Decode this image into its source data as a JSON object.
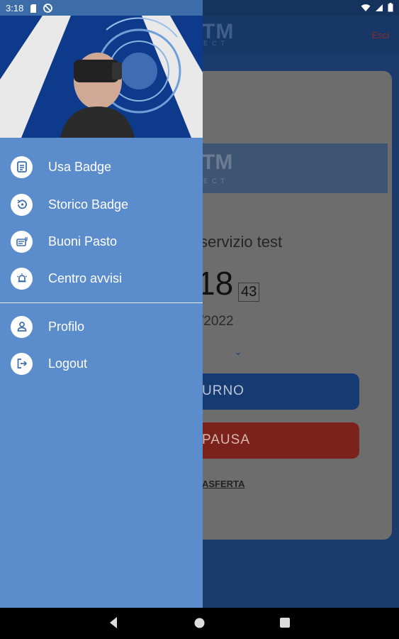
{
  "status_bar": {
    "time": "3:18"
  },
  "app": {
    "logo": "TM",
    "logo_sub": "ECT",
    "exit_label": "Esci",
    "service_name": "servizio test",
    "time_hm": "18",
    "time_sec": "43",
    "date": "/2022",
    "turno_label": "URNO",
    "pausa_label": "PAUSA",
    "trasferta_label": "ASFERTA"
  },
  "drawer": {
    "primary_items": [
      {
        "label": "Usa Badge",
        "icon": "badge-icon"
      },
      {
        "label": "Storico Badge",
        "icon": "history-icon"
      },
      {
        "label": "Buoni Pasto",
        "icon": "meal-voucher-icon"
      },
      {
        "label": "Centro avvisi",
        "icon": "alarm-bell-icon"
      }
    ],
    "secondary_items": [
      {
        "label": "Profilo",
        "icon": "user-icon"
      },
      {
        "label": "Logout",
        "icon": "logout-icon"
      }
    ]
  },
  "colors": {
    "drawer_bg": "#5b8ccb",
    "icon_fg": "#3d6fb0",
    "primary_button": "#163a72",
    "danger_button": "#7a221b"
  }
}
